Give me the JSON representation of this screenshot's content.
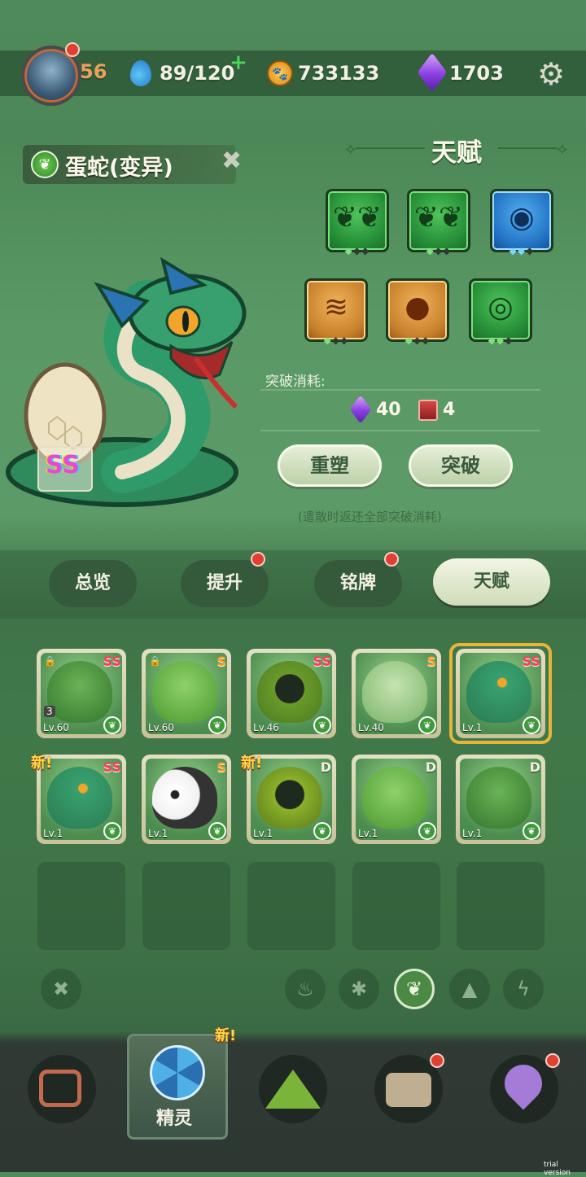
{
  "top_bar": {
    "level": "56",
    "energy": "89/120",
    "energy_plus": "+",
    "coins": "733133",
    "coin_symbol": "🐾",
    "gems": "1703",
    "settings_icon": "gear-icon"
  },
  "monster": {
    "name": "蛋蛇(变异)",
    "rank_badge": "SS",
    "element": "leaf"
  },
  "talent_panel": {
    "title": "天赋",
    "tiles": [
      {
        "icon": "leaf-cluster-icon",
        "color": "green"
      },
      {
        "icon": "leaf-cluster-icon",
        "color": "green"
      },
      {
        "icon": "eye-icon",
        "color": "blue"
      },
      {
        "icon": "mushroom-stack-icon",
        "color": "gold"
      },
      {
        "icon": "seed-drop-icon",
        "color": "gold"
      },
      {
        "icon": "spiral-icon",
        "color": "green"
      }
    ],
    "breakthrough_label": "突破消耗:",
    "cost_gems": "40",
    "cost_books": "4",
    "reshape_button": "重塑",
    "breakthrough_button": "突破",
    "note": "(遣散时返还全部突破消耗)"
  },
  "tabs": [
    {
      "label": "总览",
      "dot": false
    },
    {
      "label": "提升",
      "dot": true
    },
    {
      "label": "铭牌",
      "dot": true
    },
    {
      "label": "天赋",
      "dot": false,
      "active": true
    }
  ],
  "roster": [
    {
      "rank": "SS",
      "level": "Lv.60",
      "locked": true,
      "count": "3",
      "new": false,
      "color": "#5a9a4a"
    },
    {
      "rank": "S",
      "level": "Lv.60",
      "locked": true,
      "new": false,
      "color": "#6fb04a"
    },
    {
      "rank": "SS",
      "level": "Lv.46",
      "locked": false,
      "new": false,
      "color": "#5d8f3a"
    },
    {
      "rank": "S",
      "level": "Lv.40",
      "locked": false,
      "new": false,
      "color": "#8fbe7a"
    },
    {
      "rank": "SS",
      "level": "Lv.1",
      "locked": false,
      "new": false,
      "selected": true,
      "color": "#2f9a6a"
    },
    {
      "rank": "SS",
      "level": "Lv.1",
      "locked": false,
      "new": true,
      "color": "#2f9a6a"
    },
    {
      "rank": "S",
      "level": "Lv.1",
      "locked": false,
      "new": false,
      "color": "#eeeeee"
    },
    {
      "rank": "D",
      "level": "Lv.1",
      "locked": false,
      "new": true,
      "color": "#6f9a2a"
    },
    {
      "rank": "D",
      "level": "Lv.1",
      "locked": false,
      "new": false,
      "color": "#5aa84a"
    },
    {
      "rank": "D",
      "level": "Lv.1",
      "locked": false,
      "new": false,
      "color": "#5a9a4a"
    }
  ],
  "new_label": "新!",
  "filters": [
    "fire-icon",
    "snowflake-icon",
    "leaf-icon",
    "rock-icon",
    "lightning-icon"
  ],
  "bottom_nav": {
    "selected_label": "精灵",
    "selected_new": "新!"
  },
  "watermark": "trial version"
}
